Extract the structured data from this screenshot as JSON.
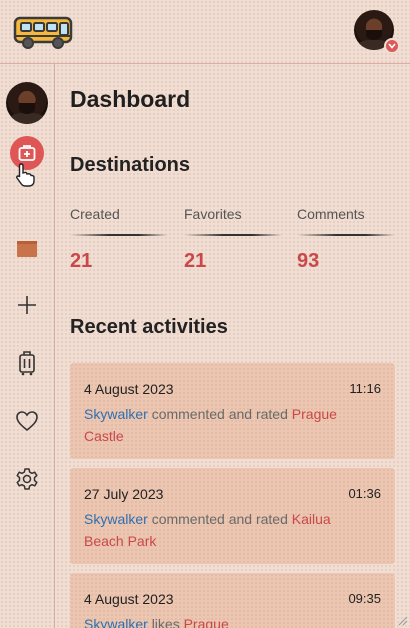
{
  "header": {
    "logo_icon": "school-bus-icon",
    "avatar_icon": "user-avatar",
    "badge_icon": "chevron-down-icon"
  },
  "sidebar": {
    "items": [
      {
        "icon": "add-destination-icon",
        "active": true
      },
      {
        "icon": "map-icon"
      },
      {
        "icon": "plus-icon"
      },
      {
        "icon": "luggage-icon"
      },
      {
        "icon": "heart-icon"
      },
      {
        "icon": "gear-icon"
      }
    ]
  },
  "main": {
    "title": "Dashboard",
    "destinations_title": "Destinations",
    "stats": [
      {
        "label": "Created",
        "value": "21"
      },
      {
        "label": "Favorites",
        "value": "21"
      },
      {
        "label": "Comments",
        "value": "93"
      }
    ],
    "recent_title": "Recent activities",
    "activities": [
      {
        "date": "4 August 2023",
        "time": "11:16",
        "user": "Skywalker",
        "action": "commented and rated",
        "place_line1": "Prague",
        "place_line2": "Castle"
      },
      {
        "date": "27 July 2023",
        "time": "01:36",
        "user": "Skywalker",
        "action": "commented and rated",
        "place_line1": "Kailua",
        "place_line2": "Beach Park"
      },
      {
        "date": "4 August 2023",
        "time": "09:35",
        "user": "Skywalker",
        "action": "likes",
        "place_line1": "Prague",
        "place_line2": ""
      }
    ]
  },
  "colors": {
    "accent": "#c9484a",
    "link": "#2f6fb0",
    "card": "#ecc6b0",
    "background": "#f1ddd2"
  }
}
